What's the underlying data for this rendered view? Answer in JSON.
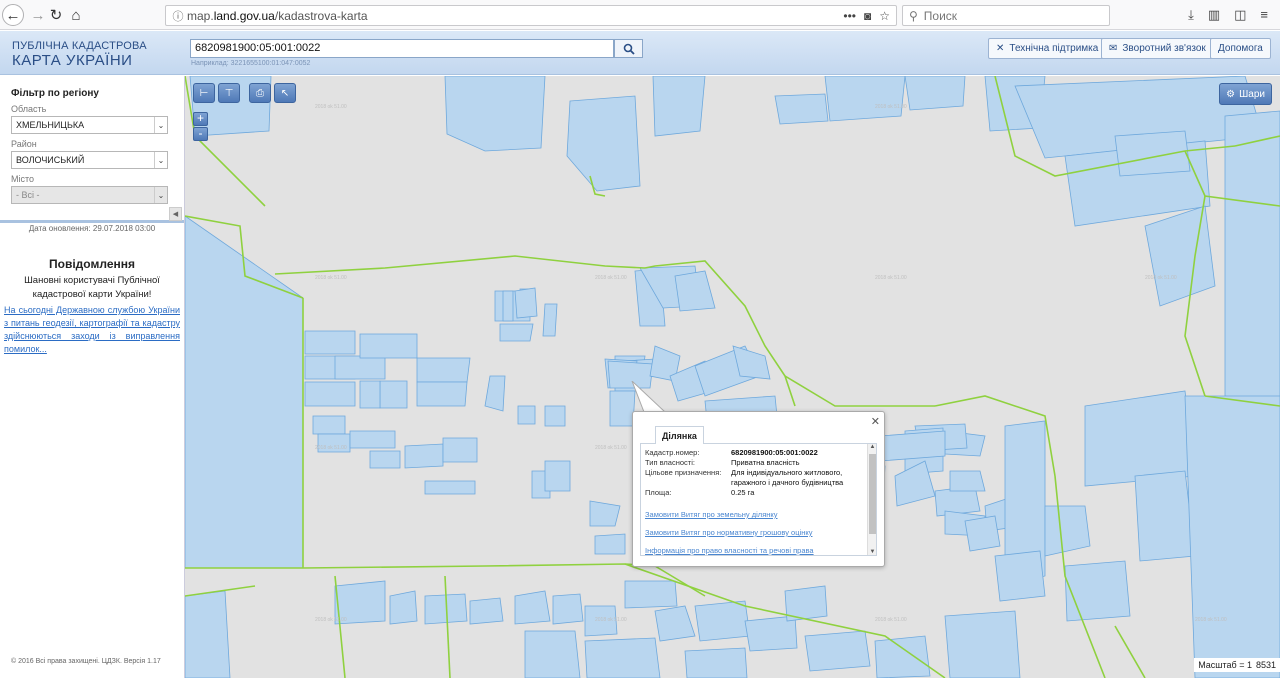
{
  "browser": {
    "url_prefix": "map.",
    "url_host": "land.gov.ua",
    "url_path": "/kadastrova-karta",
    "search_placeholder": "Поиск"
  },
  "header": {
    "logo_line1": "ПУБЛІЧНА КАДАСТРОВА",
    "logo_line2": "КАРТА УКРАЇНИ",
    "search_value": "6820981900:05:001:0022",
    "search_hint": "Наприклад: 3221655100:01:047:0052",
    "buttons": {
      "support": "Технічна підтримка",
      "feedback": "Зворотний зв'язок",
      "help": "Допомога"
    }
  },
  "sidebar": {
    "filter_title": "Фільтр по регіону",
    "region_label": "Область",
    "region_value": "ХМЕЛЬНИЦЬКА",
    "district_label": "Район",
    "district_value": "ВОЛОЧИСЬКИЙ",
    "city_label": "Місто",
    "city_value": "- Всі -",
    "updated": "Дата оновлення: 29.07.2018 03:00",
    "notice_title": "Повідомлення",
    "notice_text": "Шановні користувачі Публічної кадастрової карти України!",
    "notice_link": "На сьогодні Державною службою України з питань геодезії, картографії та кадастру здійснюються заходи із виправлення помилок...",
    "copyright": "© 2016 Всі права захищені. ЦДЗК. Версія 1.17"
  },
  "map": {
    "layers_label": "Шари",
    "scale_label": "Масштаб = 1",
    "scale_value": "8531",
    "parcel_fill": "#b9d6ef",
    "parcel_stroke": "#6ea8dc",
    "boundary_color": "#8fd13f"
  },
  "popup": {
    "tab": "Ділянка",
    "rows": [
      {
        "k": "Кадастр.номер:",
        "v": "6820981900:05:001:0022"
      },
      {
        "k": "Тип власності:",
        "v": "Приватна власність"
      },
      {
        "k": "Цільове призначення:",
        "v": "Для індивідуального житлового, гаражного і дачного будівництва"
      },
      {
        "k": "Площа:",
        "v": "0.25 га"
      }
    ],
    "link1": "Замовити Витяг про земельну ділянку",
    "link2": "Замовити Витяг про нормативну грошову оцінку",
    "link3": "Інформація про право власності та речові права"
  }
}
